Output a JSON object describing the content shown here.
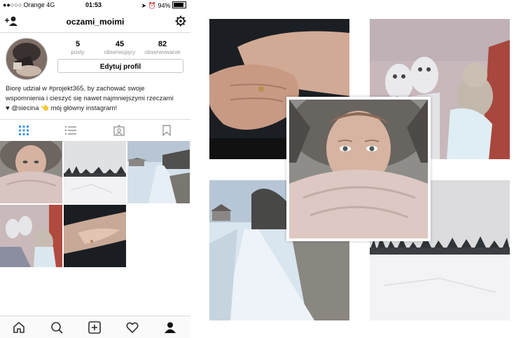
{
  "status_bar": {
    "carrier": "●●○○○ Orange",
    "network": "4G",
    "time": "01:53",
    "battery": "94%"
  },
  "profile": {
    "username": "oczami_moimi",
    "posts": {
      "count": "5",
      "label": "posty"
    },
    "followers": {
      "count": "45",
      "label": "obserwujący"
    },
    "following": {
      "count": "82",
      "label": "obserwowanie"
    },
    "edit_button": "Edytuj profil",
    "bio_line1": "Biorę udział w #projekt365, by zachować swoje",
    "bio_line2": "wspomnienia i cieszyć się nawet najmniejszymi rzeczami",
    "bio_line3": "♥ @siecina 👈 mój główny instagram!"
  },
  "tabs": [
    "grid-icon",
    "list-icon",
    "tagged-icon",
    "bookmark-icon"
  ],
  "bottom_nav": [
    "home-icon",
    "search-icon",
    "add-icon",
    "heart-icon",
    "profile-icon"
  ]
}
